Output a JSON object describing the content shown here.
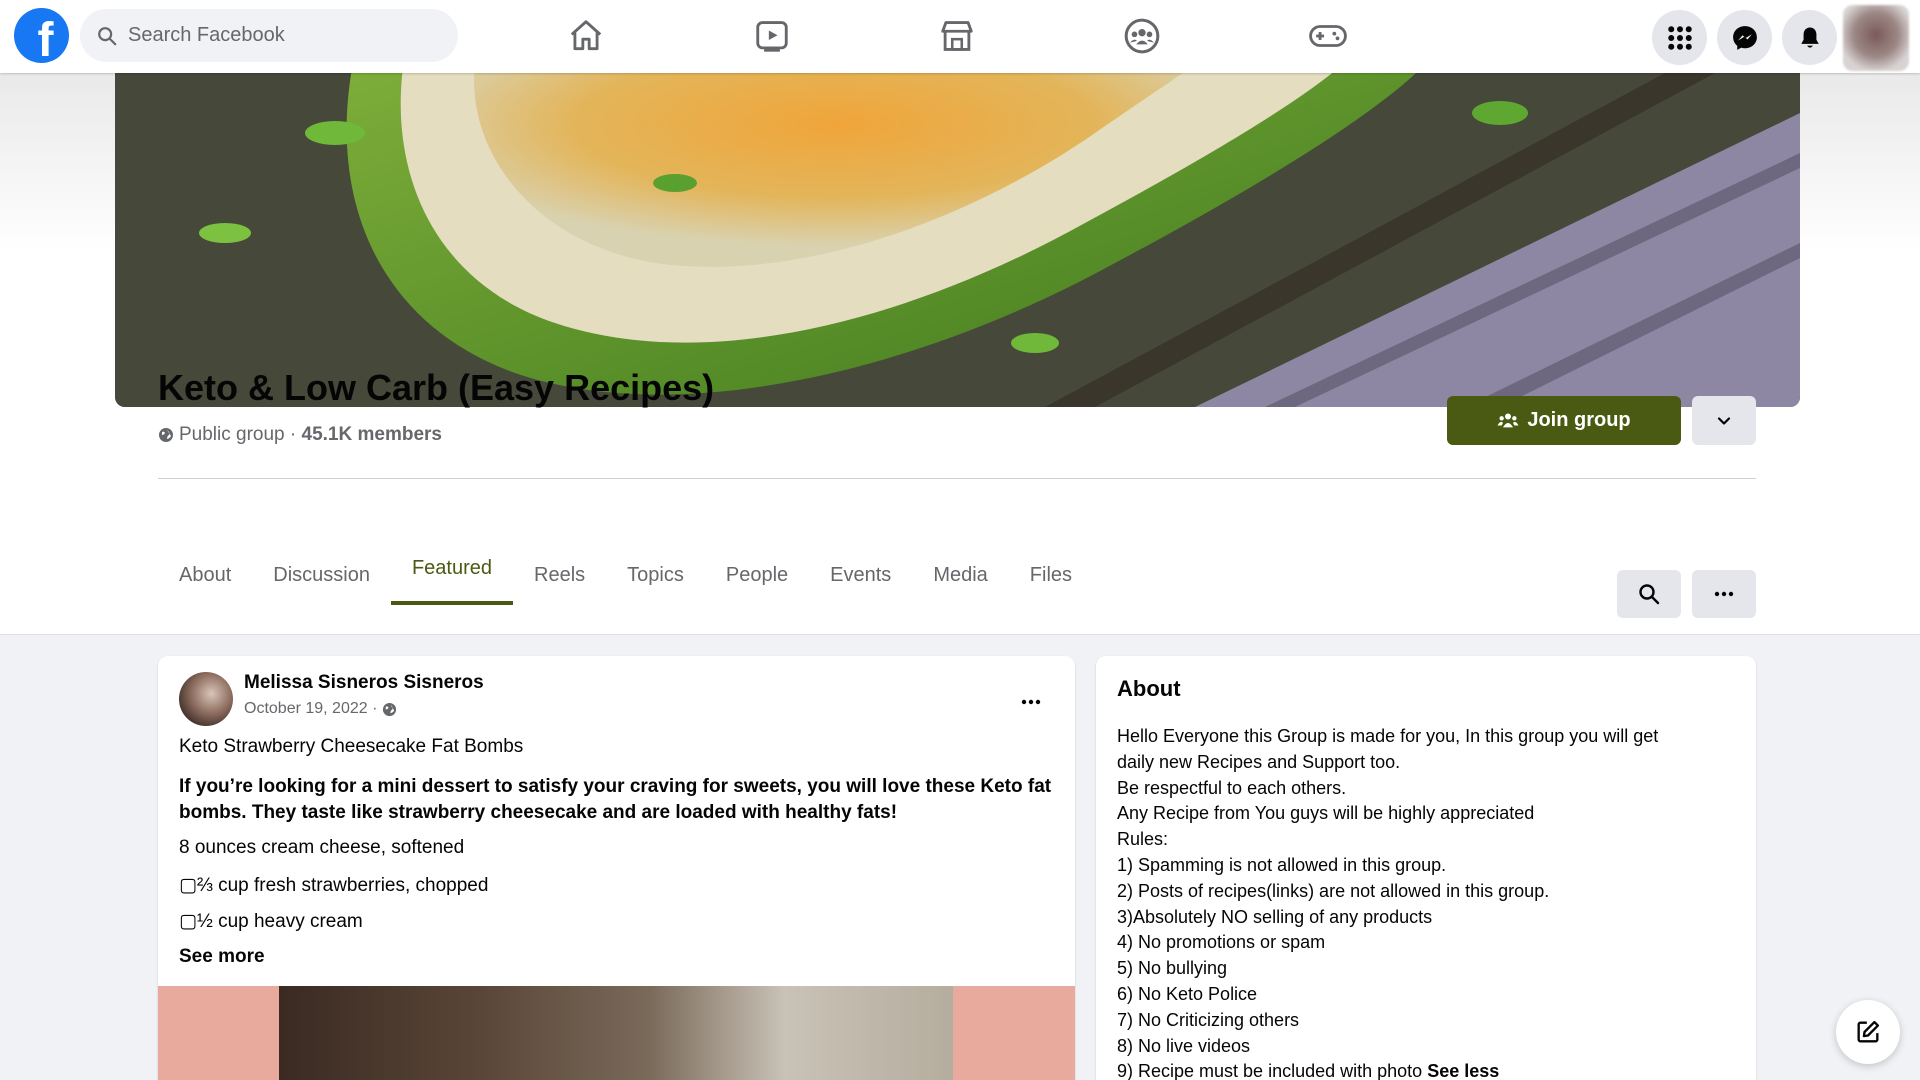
{
  "topbar": {
    "logo": "f",
    "search_placeholder": "Search Facebook",
    "nav_icons": [
      "home-icon",
      "watch-icon",
      "marketplace-icon",
      "groups-icon",
      "gaming-icon"
    ],
    "right_icons": [
      "menu-grid-icon",
      "messenger-icon",
      "notifications-icon"
    ]
  },
  "group": {
    "title": "Keto & Low Carb (Easy Recipes)",
    "privacy": "Public group",
    "separator": " · ",
    "members": "45.1K members",
    "join_label": "Join group"
  },
  "tabs": [
    {
      "label": "About",
      "active": false
    },
    {
      "label": "Discussion",
      "active": false
    },
    {
      "label": "Featured",
      "active": true
    },
    {
      "label": "Reels",
      "active": false
    },
    {
      "label": "Topics",
      "active": false
    },
    {
      "label": "People",
      "active": false
    },
    {
      "label": "Events",
      "active": false
    },
    {
      "label": "Media",
      "active": false
    },
    {
      "label": "Files",
      "active": false
    }
  ],
  "post": {
    "author": "Melissa Sisneros Sisneros",
    "date": "October 19, 2022 ·",
    "heading": "Keto Strawberry Cheesecake Fat Bombs",
    "intro": "If you’re looking for a mini dessert to satisfy your craving for sweets, you will love these Keto fat bombs. They taste like strawberry cheesecake and are loaded with healthy fats!",
    "ingredients": [
      "8 ounces cream cheese, softened",
      "▢⅔ cup fresh strawberries, chopped",
      "▢½ cup heavy cream"
    ],
    "see_more": "See more"
  },
  "about": {
    "title": "About",
    "lines": [
      "Hello Everyone this Group is made for you, In this group you will get",
      "daily new Recipes and Support too.",
      "Be respectful to each others.",
      "Any Recipe from You guys will be highly appreciated",
      "Rules:",
      "1) Spamming is not allowed in this group.",
      "2) Posts of recipes(links) are not allowed in this group.",
      "3)Absolutely NO selling of any products",
      "4) No promotions or spam",
      "5) No bullying",
      "6) No Keto Police",
      "7) No Criticizing others",
      "8) No live videos"
    ],
    "last_line": "9) Recipe must be included with photo ",
    "see_less": "See less"
  },
  "colors": {
    "facebook_blue": "#1877f2",
    "accent_olive": "#4b5a12",
    "secondary_text": "#65676b"
  }
}
